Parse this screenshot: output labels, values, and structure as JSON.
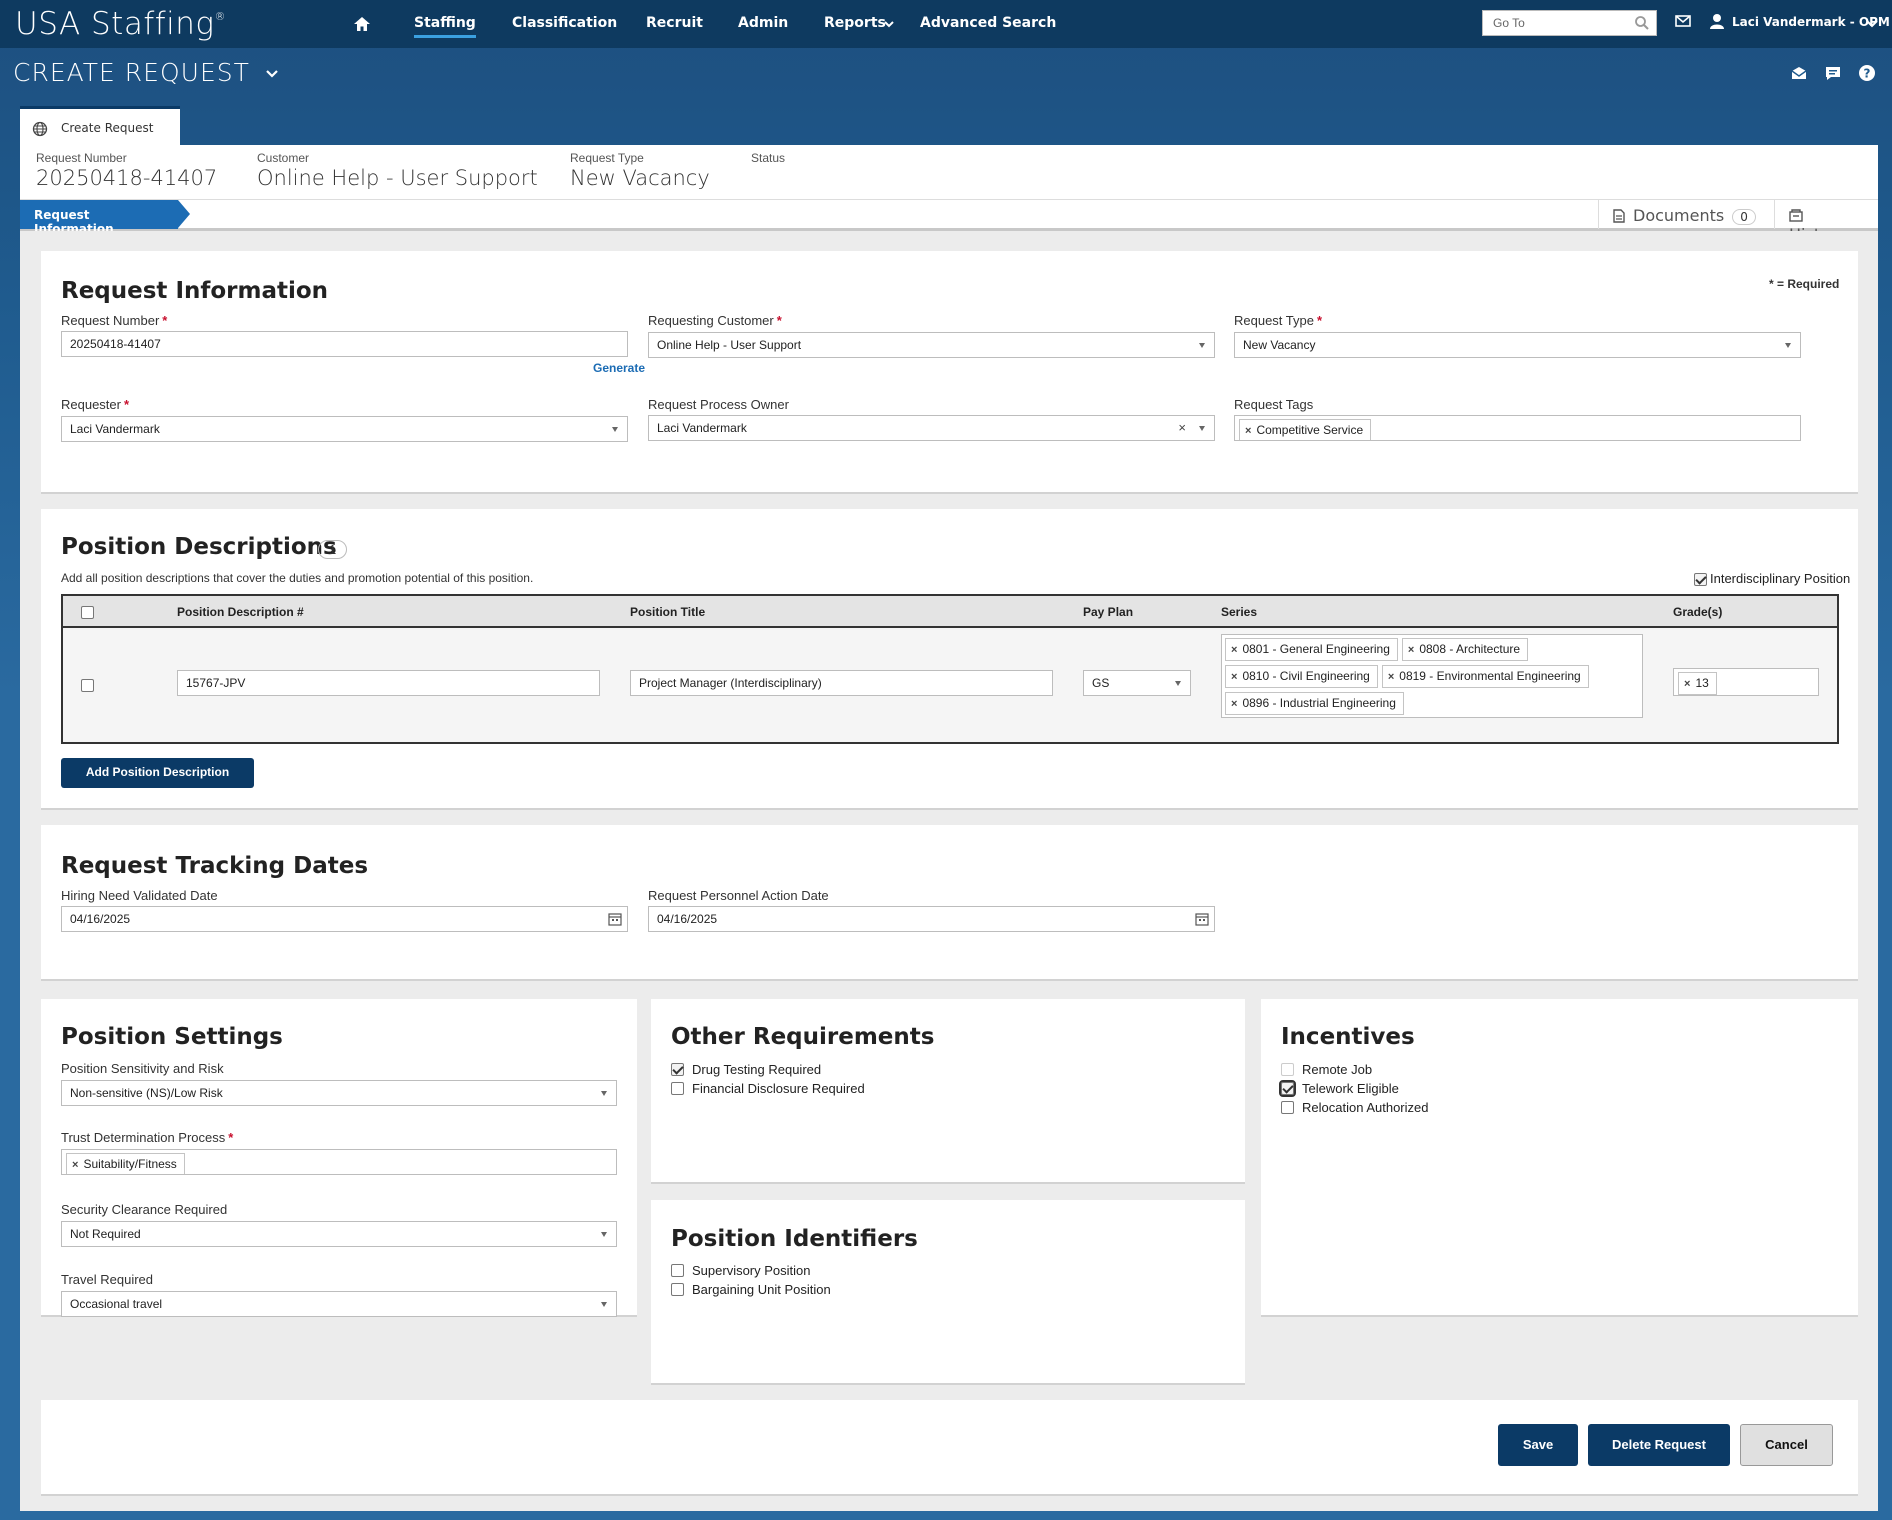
{
  "nav": {
    "logo": "USA Staffing",
    "logo_mark": "®",
    "links": [
      "Staffing",
      "Classification",
      "Recruit",
      "Admin",
      "Reports",
      "Advanced Search"
    ],
    "goto_placeholder": "Go To",
    "user": "Laci Vandermark - OPM"
  },
  "page": {
    "title": "CREATE REQUEST",
    "tab": "Create Request"
  },
  "summary": {
    "request_number_label": "Request Number",
    "request_number": "20250418-41407",
    "customer_label": "Customer",
    "customer": "Online Help - User Support",
    "request_type_label": "Request Type",
    "request_type": "New Vacancy",
    "status_label": "Status",
    "status": ""
  },
  "subbar": {
    "crumb": "Request Information",
    "documents": "Documents",
    "documents_count": "0",
    "history": "History"
  },
  "request_info": {
    "title": "Request Information",
    "required_note": "* = Required",
    "request_number_label": "Request Number",
    "request_number": "20250418-41407",
    "generate": "Generate",
    "requesting_customer_label": "Requesting Customer",
    "requesting_customer": "Online Help - User Support",
    "request_type_label": "Request Type",
    "request_type": "New Vacancy",
    "requester_label": "Requester",
    "requester": "Laci Vandermark",
    "process_owner_label": "Request Process Owner",
    "process_owner": "Laci Vandermark",
    "tags_label": "Request Tags",
    "tags": [
      "Competitive Service"
    ]
  },
  "position_descriptions": {
    "title": "Position Descriptions",
    "count": "1",
    "subtitle": "Add all position descriptions that cover the duties and promotion potential of this position.",
    "interdisciplinary_label": "Interdisciplinary Position",
    "interdisciplinary": true,
    "columns": [
      "Position Description #",
      "Position Title",
      "Pay Plan",
      "Series",
      "Grade(s)"
    ],
    "rows": [
      {
        "pd_number": "15767-JPV",
        "title": "Project Manager (Interdisciplinary)",
        "pay_plan": "GS",
        "series": [
          "0801 - General Engineering",
          "0808 - Architecture",
          "0810 - Civil Engineering",
          "0819 - Environmental Engineering",
          "0896 - Industrial Engineering"
        ],
        "grades": [
          "13"
        ]
      }
    ],
    "add_button": "Add Position Description"
  },
  "tracking": {
    "title": "Request Tracking Dates",
    "hiring_label": "Hiring Need Validated Date",
    "hiring_date": "04/16/2025",
    "pa_label": "Request Personnel Action Date",
    "pa_date": "04/16/2025"
  },
  "position_settings": {
    "title": "Position Settings",
    "sensitivity_label": "Position Sensitivity and Risk",
    "sensitivity": "Non-sensitive (NS)/Low Risk",
    "trust_label": "Trust Determination Process",
    "trust": [
      "Suitability/Fitness"
    ],
    "clearance_label": "Security Clearance Required",
    "clearance": "Not Required",
    "travel_label": "Travel Required",
    "travel": "Occasional travel"
  },
  "other_requirements": {
    "title": "Other Requirements",
    "items": [
      {
        "label": "Drug Testing Required",
        "checked": true
      },
      {
        "label": "Financial Disclosure Required",
        "checked": false
      }
    ]
  },
  "position_identifiers": {
    "title": "Position Identifiers",
    "items": [
      {
        "label": "Supervisory Position",
        "checked": false
      },
      {
        "label": "Bargaining Unit Position",
        "checked": false
      }
    ]
  },
  "incentives": {
    "title": "Incentives",
    "items": [
      {
        "label": "Remote Job",
        "checked": false
      },
      {
        "label": "Telework Eligible",
        "checked": true
      },
      {
        "label": "Relocation Authorized",
        "checked": false
      }
    ]
  },
  "actions": {
    "save": "Save",
    "delete": "Delete Request",
    "cancel": "Cancel"
  },
  "colors": {
    "nav_bg": "#0e3a60",
    "primary": "#0b3a66",
    "accent": "#1c6cb4",
    "required": "#c8102e"
  }
}
